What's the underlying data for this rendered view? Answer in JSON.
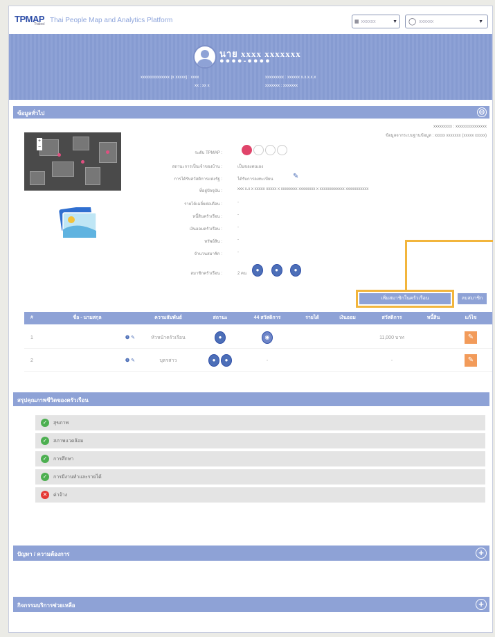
{
  "header": {
    "logo": "TPMAP",
    "logo_sub": "Thailand",
    "app_title": "Thai People Map and Analytics Platform",
    "calendar_value": "xxxxxx",
    "user_value": "xxxxxx"
  },
  "profile": {
    "name": "นาย xxxx xxxxxxx",
    "id_masked": "●●●●-●●●●",
    "info": [
      "xxxxxxxxxxxxxx (x xxxxx) : xxxx",
      "xxxxxxxxx : xxxxxx x.x.x.x.x",
      "xx : xx x",
      "xxxxxxx : xxxxxxx"
    ]
  },
  "panels": {
    "profile_head": "ข้อมูลทั่วไป",
    "quality_head": "สรุปคุณภาพชีวิตของครัวเรือน",
    "problem_head": "ปัญหา / ความต้องการ",
    "service_head": "กิจกรรมบริการช่วยเหลือ"
  },
  "right_notes": {
    "line1": "xxxxxxxxx : xxxxxxxxxxxxxxx",
    "line2": "ข้อมูลจากระบบฐานข้อมูล : xxxxx xxxxxxx (xxxxx xxxxx)"
  },
  "details": [
    {
      "label": "ระดับ TPMAP :",
      "value": ""
    },
    {
      "label": "สถานะการเป็นเจ้าของบ้าน :",
      "value": "เป็นของตนเอง"
    },
    {
      "label": "การได้รับสวัสดิการแห่งรัฐ :",
      "value": "ได้รับการลงทะเบียน"
    },
    {
      "label": "ที่อยู่ปัจจุบัน :",
      "value": "xxx x.x x xxxxx xxxxx x xxxxxxxx xxxxxxxx x xxxxxxxxxxxx xxxxxxxxxxx"
    },
    {
      "label": "รายได้เฉลี่ยต่อเดือน :",
      "value": "-"
    },
    {
      "label": "หนี้สินครัวเรือน :",
      "value": "-"
    },
    {
      "label": "เงินออมครัวเรือน :",
      "value": "-"
    },
    {
      "label": "ทรัพย์สิน :",
      "value": "-"
    },
    {
      "label": "จำนวนสมาชิก :",
      "value": "-"
    },
    {
      "label": "สมาชิกครัวเรือน :",
      "value": "2 คน"
    }
  ],
  "buttons": {
    "add_member": "เพิ่มสมาชิกในครัวเรือน",
    "delete": "ลบสมาชิก"
  },
  "table": {
    "headers": [
      "#",
      "ชื่อ - นามสกุล",
      "ความสัมพันธ์",
      "สถานะ",
      "44 สวัสดิการ",
      "รายได้",
      "เงินออม",
      "สวัสดิการ",
      "หนี้สิน",
      "แก้ไข"
    ],
    "rows": [
      {
        "num": "1",
        "relation": "หัวหน้าครัวเรือน",
        "income": "11,000 บาท"
      },
      {
        "num": "2",
        "relation": "บุตรสาว",
        "income": "-"
      }
    ]
  },
  "quality": [
    {
      "label": "สุขภาพ",
      "ok": true
    },
    {
      "label": "สภาพแวดล้อม",
      "ok": true
    },
    {
      "label": "การศึกษา",
      "ok": true
    },
    {
      "label": "การมีงานทำและรายได้",
      "ok": true
    },
    {
      "label": "ค่าจ้าง",
      "ok": false
    }
  ],
  "colors": {
    "primary": "#8ea2d6",
    "highlight": "#f2b53c",
    "edit": "#f29b5a",
    "ok": "#4caf50",
    "fail": "#e53935"
  }
}
